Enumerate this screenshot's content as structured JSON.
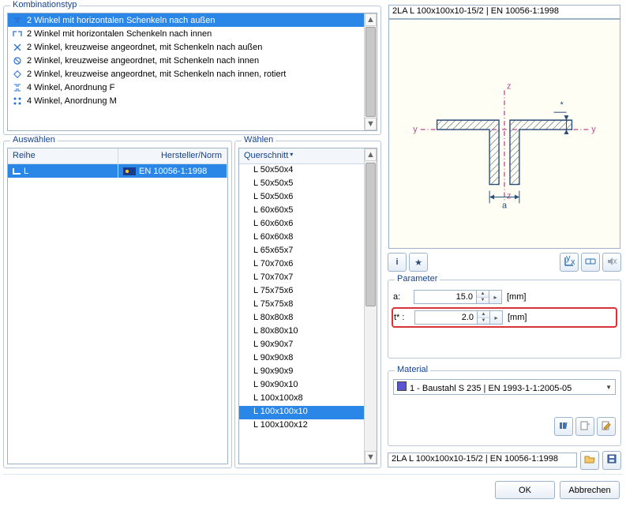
{
  "kombi": {
    "title": "Kombinationstyp",
    "items": [
      {
        "label": "2 Winkel mit horizontalen Schenkeln nach außen",
        "icon": "angle-pair-out",
        "selected": true
      },
      {
        "label": "2 Winkel mit horizontalen Schenkeln nach innen",
        "icon": "angle-pair-in"
      },
      {
        "label": "2 Winkel, kreuzweise angeordnet, mit Schenkeln nach außen",
        "icon": "angle-cross-out"
      },
      {
        "label": "2 Winkel, kreuzweise angeordnet, mit Schenkeln nach innen",
        "icon": "angle-cross-in"
      },
      {
        "label": "2 Winkel, kreuzweise angeordnet, mit Schenkeln nach innen, rotiert",
        "icon": "angle-cross-in-rot"
      },
      {
        "label": "4 Winkel, Anordnung F",
        "icon": "angle-four-f"
      },
      {
        "label": "4 Winkel, Anordnung M",
        "icon": "angle-four-m"
      }
    ]
  },
  "auswaehlen": {
    "title": "Auswählen",
    "head_reihe": "Reihe",
    "head_norm": "Hersteller/Norm",
    "rows": [
      {
        "reihe_icon": "L",
        "reihe": "L",
        "norm_flag": "eu",
        "norm": "EN 10056-1:1998",
        "selected": true
      }
    ]
  },
  "waehlen": {
    "title": "Wählen",
    "head": "Querschnitt",
    "items": [
      {
        "label": "L 50x50x4"
      },
      {
        "label": "L 50x50x5"
      },
      {
        "label": "L 50x50x6"
      },
      {
        "label": "L 60x60x5"
      },
      {
        "label": "L 60x60x6"
      },
      {
        "label": "L 60x60x8"
      },
      {
        "label": "L 65x65x7"
      },
      {
        "label": "L 70x70x6"
      },
      {
        "label": "L 70x70x7"
      },
      {
        "label": "L 75x75x6"
      },
      {
        "label": "L 75x75x8"
      },
      {
        "label": "L 80x80x8"
      },
      {
        "label": "L 80x80x10"
      },
      {
        "label": "L 90x90x7"
      },
      {
        "label": "L 90x90x8"
      },
      {
        "label": "L 90x90x9"
      },
      {
        "label": "L 90x90x10"
      },
      {
        "label": "L 100x100x8"
      },
      {
        "label": "L 100x100x10",
        "selected": true
      },
      {
        "label": "L 100x100x12"
      }
    ]
  },
  "preview_title": "2LA L 100x100x10-15/2 | EN 10056-1:1998",
  "toolbar": {
    "left": [
      "info-icon",
      "favorite-icon"
    ],
    "right": [
      "axis-xy-icon",
      "toggle-icon",
      "mute-icon"
    ]
  },
  "parameter": {
    "title": "Parameter",
    "rows": [
      {
        "label": "a:",
        "value": "15.0",
        "unit": "[mm]",
        "highlight": false
      },
      {
        "label": "t* :",
        "value": "2.0",
        "unit": "[mm]",
        "highlight": true
      }
    ]
  },
  "material": {
    "title": "Material",
    "value": "1 - Baustahl S 235 | EN 1993-1-1:2005-05",
    "color": "#5b55d6",
    "buttons": [
      "library-icon",
      "new-icon",
      "edit-icon"
    ]
  },
  "summary": {
    "value": "2LA L 100x100x10-15/2 | EN 10056-1:1998",
    "buttons": [
      "open-icon",
      "save-icon"
    ]
  },
  "dialog": {
    "ok": "OK",
    "cancel": "Abbrechen"
  }
}
